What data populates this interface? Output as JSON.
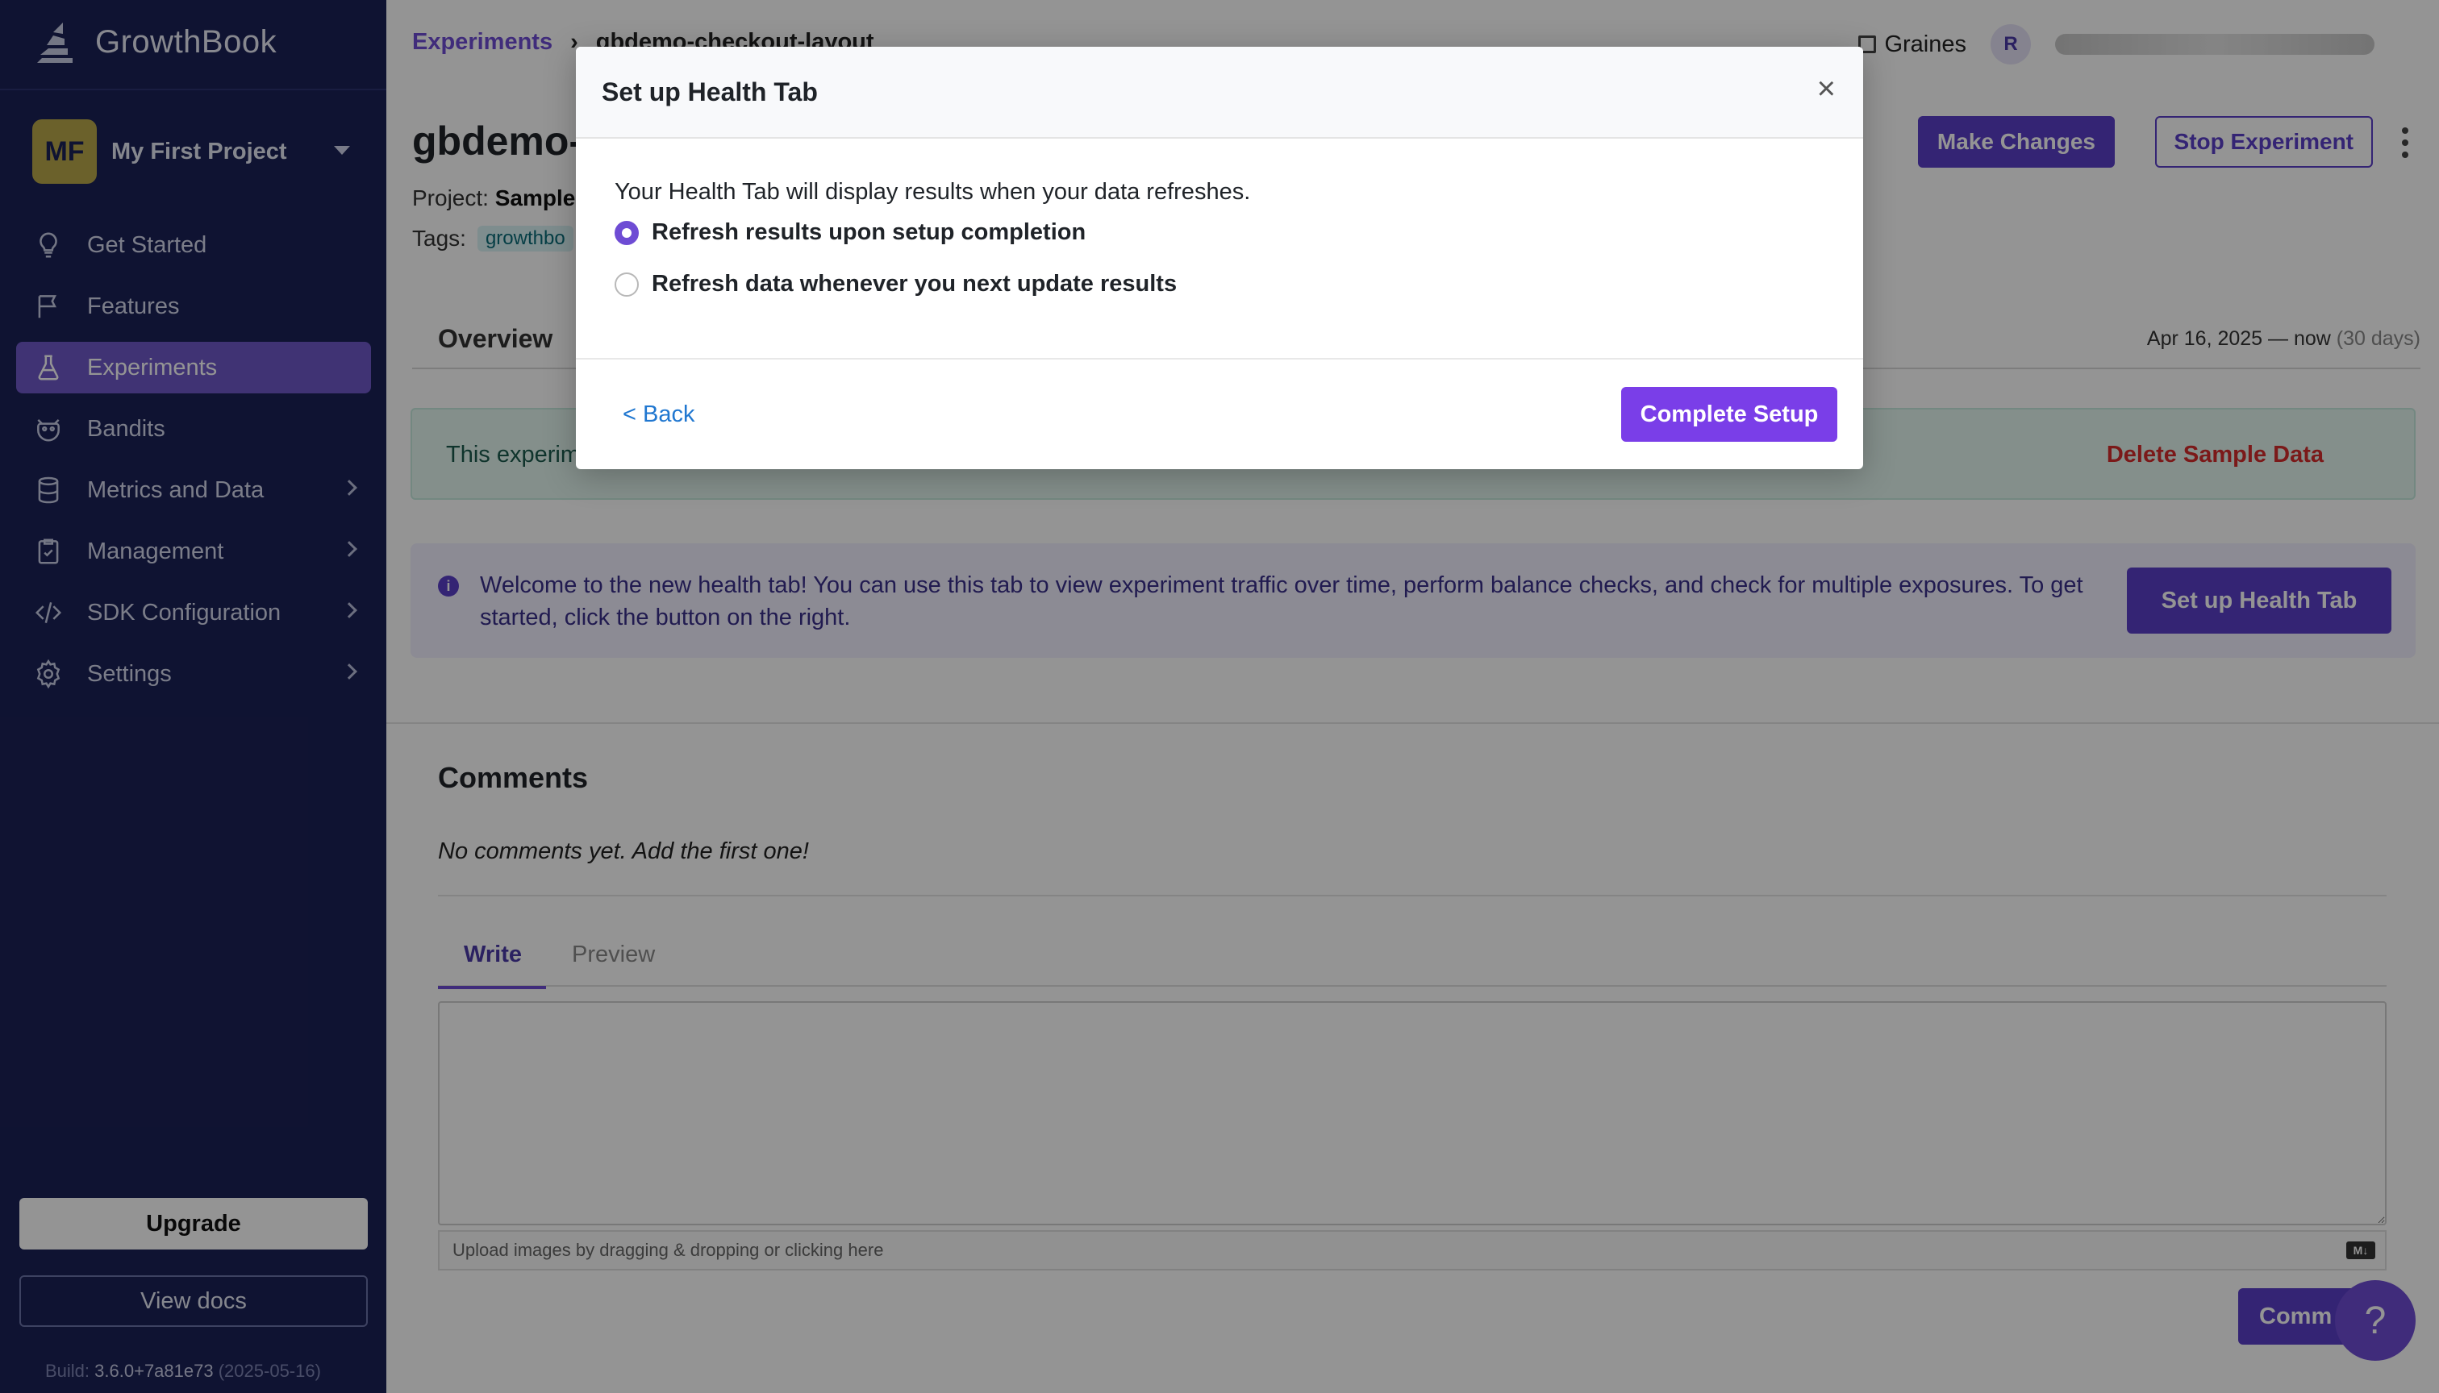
{
  "app": {
    "name": "GrowthBook"
  },
  "sidebar": {
    "project": {
      "initials": "MF",
      "name": "My First Project"
    },
    "items": [
      {
        "label": "Get Started",
        "icon": "lightbulb-icon"
      },
      {
        "label": "Features",
        "icon": "flag-icon"
      },
      {
        "label": "Experiments",
        "icon": "flask-icon",
        "active": true
      },
      {
        "label": "Bandits",
        "icon": "bandit-icon"
      },
      {
        "label": "Metrics and Data",
        "icon": "database-icon"
      },
      {
        "label": "Management",
        "icon": "clipboard-icon"
      },
      {
        "label": "SDK Configuration",
        "icon": "code-icon"
      },
      {
        "label": "Settings",
        "icon": "gear-icon"
      }
    ],
    "upgrade_label": "Upgrade",
    "docs_label": "View docs",
    "build_prefix": "Build:",
    "build_version": "3.6.0+7a81e73",
    "build_date": "(2025-05-16)"
  },
  "header": {
    "breadcrumb_link": "Experiments",
    "breadcrumb_sep": "›",
    "breadcrumb_current": "gbdemo-checkout-layout",
    "org_name": "Graines",
    "user_initial": "R"
  },
  "experiment": {
    "title": "gbdemo-",
    "project_label": "Project:",
    "project_value": "Sample",
    "tags_label": "Tags:",
    "tag": "growthbo",
    "make_changes": "Make Changes",
    "stop_experiment": "Stop Experiment"
  },
  "tabs": {
    "overview": "Overview",
    "date_range": "Apr 16, 2025 — now",
    "date_days": "(30 days)"
  },
  "sample_alert": {
    "text": "This experim",
    "delete_label": "Delete Sample Data"
  },
  "health_alert": {
    "icon": "info-icon",
    "text": "Welcome to the new health tab! You can use this tab to view experiment traffic over time, perform balance checks, and check for multiple exposures. To get started, click the button on the right.",
    "button": "Set up Health Tab"
  },
  "comments": {
    "heading": "Comments",
    "empty": "No comments yet. Add the first one!",
    "tab_write": "Write",
    "tab_preview": "Preview",
    "upload_hint": "Upload images by dragging & dropping or clicking here",
    "md_badge": "M↓",
    "submit": "Comm",
    "help": "?"
  },
  "modal": {
    "title": "Set up Health Tab",
    "close": "×",
    "description": "Your Health Tab will display results when your data refreshes.",
    "options": [
      {
        "label": "Refresh results upon setup completion",
        "checked": true
      },
      {
        "label": "Refresh data whenever you next update results",
        "checked": false
      }
    ],
    "back": "< Back",
    "complete": "Complete Setup"
  }
}
